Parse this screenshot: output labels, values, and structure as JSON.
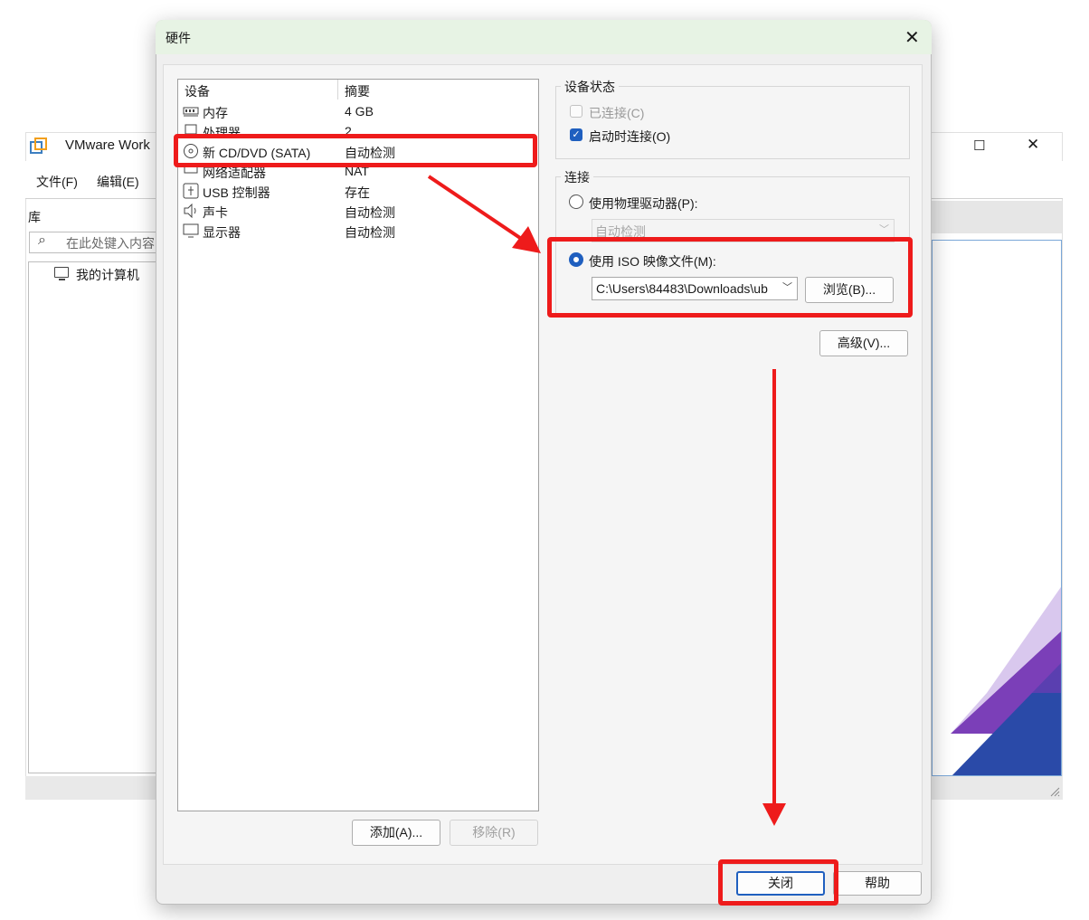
{
  "background_window": {
    "title": "VMware Work",
    "menu": [
      "文件(F)",
      "编辑(E)"
    ],
    "library_label": "库",
    "search_placeholder": "在此处键入内容",
    "tree_item": "我的计算机",
    "icons": [
      "vmware-logo-icon",
      "maximize-icon",
      "close-icon",
      "search-icon",
      "computer-icon",
      "resize-grip-icon"
    ]
  },
  "dialog": {
    "title": "硬件",
    "device_list": {
      "header_device": "设备",
      "header_summary": "摘要",
      "rows": [
        {
          "name": "内存",
          "summary": "4 GB",
          "icon": "memory-icon"
        },
        {
          "name": "处理器",
          "summary": "2",
          "icon": "processor-icon"
        },
        {
          "name": "新 CD/DVD (SATA)",
          "summary": "自动检测",
          "icon": "cd-dvd-icon"
        },
        {
          "name": "网络适配器",
          "summary": "NAT",
          "icon": "network-adapter-icon"
        },
        {
          "name": "USB 控制器",
          "summary": "存在",
          "icon": "usb-icon"
        },
        {
          "name": "声卡",
          "summary": "自动检测",
          "icon": "sound-card-icon"
        },
        {
          "name": "显示器",
          "summary": "自动检测",
          "icon": "display-icon"
        }
      ]
    },
    "device_status": {
      "label": "设备状态",
      "connected": {
        "label": "已连接(C)",
        "checked": false,
        "disabled": true
      },
      "connect_on_start": {
        "label": "启动时连接(O)",
        "checked": true
      }
    },
    "connection": {
      "label": "连接",
      "physical_drive": {
        "label": "使用物理驱动器(P):",
        "selected": false,
        "value": "自动检测"
      },
      "iso_file": {
        "label": "使用 ISO 映像文件(M):",
        "selected": true,
        "value": "C:\\Users\\84483\\Downloads\\ub"
      },
      "browse_button": "浏览(B)..."
    },
    "advanced_button": "高级(V)...",
    "add_button": "添加(A)...",
    "remove_button": "移除(R)",
    "close_button": "关闭",
    "help_button": "帮助"
  },
  "annotations": {
    "color": "#ee1b1b"
  }
}
